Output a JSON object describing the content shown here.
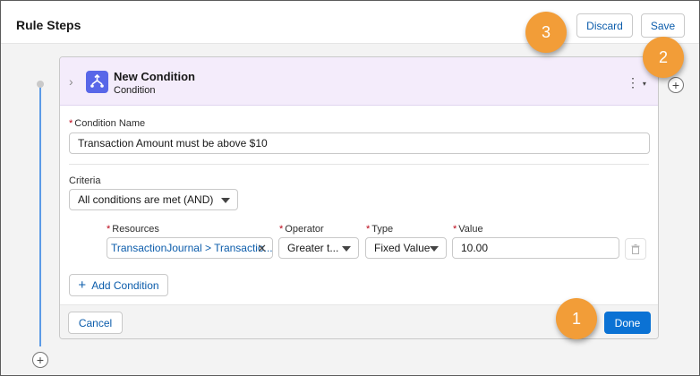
{
  "header": {
    "title": "Rule Steps",
    "discard_label": "Discard",
    "save_label": "Save"
  },
  "badges": [
    "1",
    "2",
    "3"
  ],
  "condition": {
    "title": "New Condition",
    "subtitle": "Condition",
    "name_label": "Condition Name",
    "name_value": "Transaction Amount must be above $10",
    "criteria_label": "Criteria",
    "criteria_value": "All conditions are met (AND)",
    "row": {
      "resources_label": "Resources",
      "resources_value": "TransactionJournal > Transactio...",
      "operator_label": "Operator",
      "operator_value": "Greater t...",
      "type_label": "Type",
      "type_value": "Fixed Value",
      "value_label": "Value",
      "value_value": "10.00"
    },
    "add_condition_label": "Add Condition",
    "cancel_label": "Cancel",
    "done_label": "Done"
  },
  "colors": {
    "accent": "#0b72d4",
    "badge": "#f29d38",
    "condition_icon": "#5867e8",
    "card_header": "#f4ecfb"
  },
  "icons": [
    "chevron-right-icon",
    "condition-branch-icon",
    "kebab-menu-icon",
    "close-icon",
    "trash-icon",
    "plus-icon",
    "add-step-icon"
  ]
}
